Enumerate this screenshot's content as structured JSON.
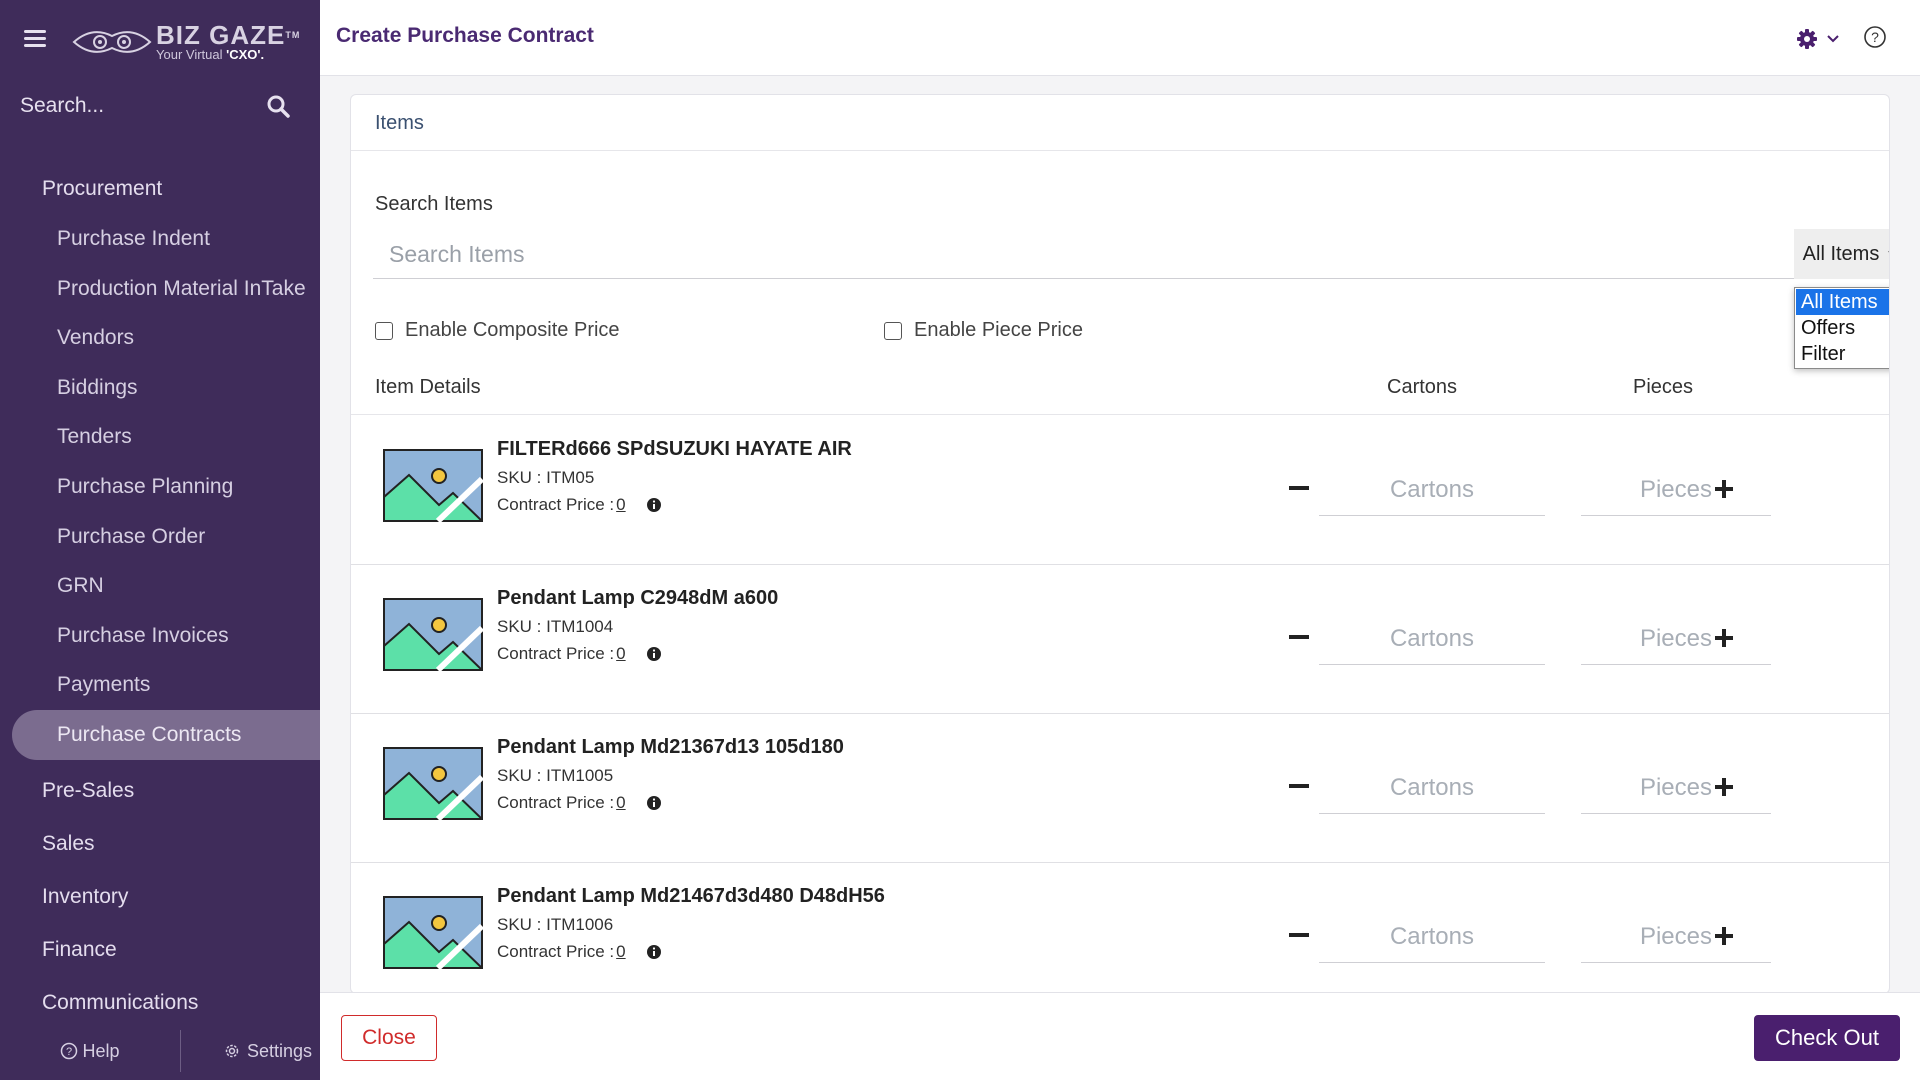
{
  "sidebar": {
    "brand": "BIZ GAZE",
    "tm": "TM",
    "tagline": "Your Virtual",
    "tagline_strong": "'CXO'.",
    "search_placeholder": "Search...",
    "sections": [
      {
        "label": "Procurement"
      }
    ],
    "procurement_items": [
      {
        "label": "Purchase Indent"
      },
      {
        "label": "Production Material InTake"
      },
      {
        "label": "Vendors"
      },
      {
        "label": "Biddings"
      },
      {
        "label": "Tenders"
      },
      {
        "label": "Purchase Planning"
      },
      {
        "label": "Purchase Order"
      },
      {
        "label": "GRN"
      },
      {
        "label": "Purchase Invoices"
      },
      {
        "label": "Payments"
      },
      {
        "label": "Purchase Contracts"
      }
    ],
    "other_sections": [
      {
        "label": "Pre-Sales"
      },
      {
        "label": "Sales"
      },
      {
        "label": "Inventory"
      },
      {
        "label": "Finance"
      },
      {
        "label": "Communications"
      }
    ],
    "footer": {
      "help": "Help",
      "settings": "Settings"
    }
  },
  "header": {
    "title": "Create Purchase Contract"
  },
  "card": {
    "title": "Items",
    "search_label": "Search Items",
    "search_placeholder": "Search Items",
    "filter_selected": "All Items",
    "filter_options": [
      "All Items",
      "Offers",
      "Filter"
    ],
    "enable_composite": "Enable Composite Price",
    "enable_piece": "Enable Piece Price",
    "col_details": "Item Details",
    "col_cartons": "Cartons",
    "col_pieces": "Pieces",
    "cartons_placeholder": "Cartons",
    "pieces_placeholder": "Pieces",
    "items": [
      {
        "name": "FILTERd666 SPdSUZUKI HAYATE AIR",
        "sku": "SKU : ITM05",
        "price_label": "Contract Price :",
        "price": "0"
      },
      {
        "name": "Pendant Lamp C2948dM a600",
        "sku": "SKU : ITM1004",
        "price_label": "Contract Price :",
        "price": "0"
      },
      {
        "name": "Pendant Lamp Md21367d13 105d180",
        "sku": "SKU : ITM1005",
        "price_label": "Contract Price :",
        "price": "0"
      },
      {
        "name": "Pendant Lamp Md21467d3d480 D48dH56",
        "sku": "SKU : ITM1006",
        "price_label": "Contract Price :",
        "price": "0"
      }
    ]
  },
  "footer": {
    "close": "Close",
    "checkout": "Check Out"
  },
  "colors": {
    "sidebar_bg": "#3f2c5a",
    "brand_purple": "#4a1f6e",
    "close_red": "#d02b2b",
    "dropdown_selected": "#1a73e8"
  }
}
